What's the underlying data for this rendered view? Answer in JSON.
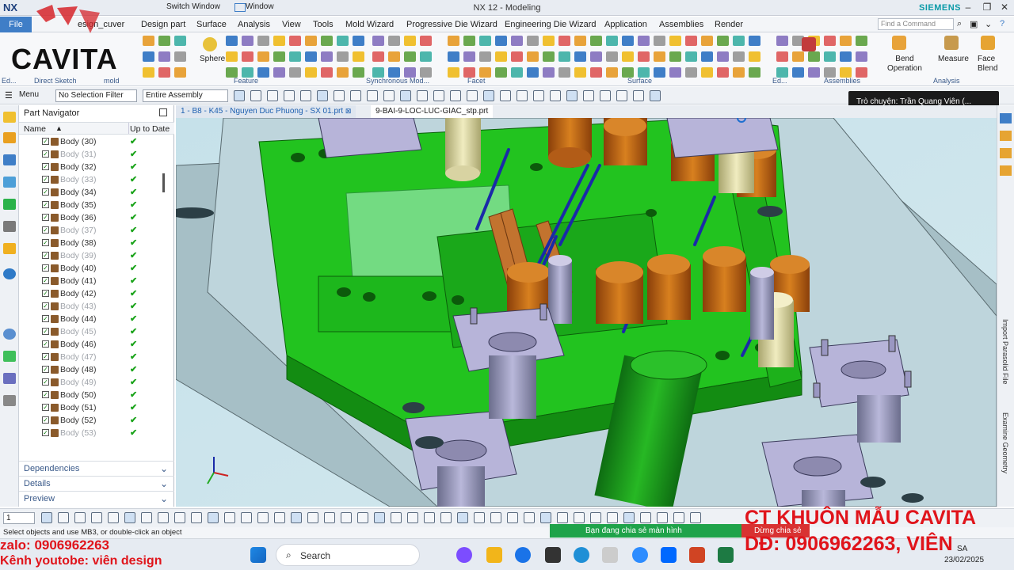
{
  "titlebar": {
    "app_short": "NX",
    "switch_window": "Switch Window",
    "window": "Window",
    "title": "NX 12 - Modeling",
    "brand": "SIEMENS"
  },
  "menubar": {
    "file": "File",
    "items": [
      "esign_cuver",
      "Design part",
      "Surface",
      "Analysis",
      "View",
      "Tools",
      "Mold Wizard",
      "Progressive Die Wizard",
      "Engineering Die Wizard",
      "Application",
      "Assemblies",
      "Render"
    ],
    "find_placeholder": "Find a Command"
  },
  "ribbon": {
    "groups": [
      "Ed...",
      "Direct Sketch",
      "mold",
      "Feature",
      "Synchronous Mod...",
      "Facet",
      "Surface",
      "Ed...",
      "Assemblies",
      "Analysis"
    ],
    "sphere": "Sphere",
    "bend_operation": "Bend\nOperation",
    "measure": "Measure",
    "face_blend": "Face\nBlend"
  },
  "toolbar": {
    "menu": "Menu",
    "filter": "No Selection Filter",
    "scope": "Entire Assembly"
  },
  "chat_popup": "Trò chuyện: Trần Quang Viên (...",
  "navigator": {
    "title": "Part Navigator",
    "col_name": "Name",
    "col_uptodate": "Up to Date",
    "rows": [
      {
        "label": "Body (30)",
        "dim": false
      },
      {
        "label": "Body (31)",
        "dim": true
      },
      {
        "label": "Body (32)",
        "dim": false
      },
      {
        "label": "Body (33)",
        "dim": true
      },
      {
        "label": "Body (34)",
        "dim": false
      },
      {
        "label": "Body (35)",
        "dim": false
      },
      {
        "label": "Body (36)",
        "dim": false
      },
      {
        "label": "Body (37)",
        "dim": true
      },
      {
        "label": "Body (38)",
        "dim": false
      },
      {
        "label": "Body (39)",
        "dim": true
      },
      {
        "label": "Body (40)",
        "dim": false
      },
      {
        "label": "Body (41)",
        "dim": false
      },
      {
        "label": "Body (42)",
        "dim": false
      },
      {
        "label": "Body (43)",
        "dim": true
      },
      {
        "label": "Body (44)",
        "dim": false
      },
      {
        "label": "Body (45)",
        "dim": true
      },
      {
        "label": "Body (46)",
        "dim": false
      },
      {
        "label": "Body (47)",
        "dim": true
      },
      {
        "label": "Body (48)",
        "dim": false
      },
      {
        "label": "Body (49)",
        "dim": true
      },
      {
        "label": "Body (50)",
        "dim": false
      },
      {
        "label": "Body (51)",
        "dim": false
      },
      {
        "label": "Body (52)",
        "dim": false
      },
      {
        "label": "Body (53)",
        "dim": true
      }
    ],
    "sections": [
      "Dependencies",
      "Details",
      "Preview"
    ]
  },
  "tabs": [
    "1 - B8 - K45 - Nguyen Duc Phuong - SX 01.prt",
    "9-BAI-9-LOC-LUC-GIAC_stp.prt"
  ],
  "right_strip_texts": [
    "Import Parasolid File",
    "Examine Geometry"
  ],
  "status": "Select objects and use MB3, or double-click an object",
  "bottom_zoom": "1",
  "sharing": {
    "message": "Bạn đang chia sẻ màn hình",
    "stop": "Dừng chia sẻ"
  },
  "taskbar": {
    "search": "Search",
    "time": "SA",
    "date": "23/02/2025"
  },
  "watermark": {
    "logo": "CAVITA",
    "zalo": "zalo: 0906962263",
    "youtube": "Kênh youtobe: viên design",
    "right1": "CT KHUÔN MẪU CAVITA",
    "right2": "DĐ: 0906962263, VIÊN"
  },
  "colors": {
    "accent": "#3f7ec7",
    "green_plate": "#22c31f",
    "orange_pin": "#c8691c",
    "lavender": "#b7b4d9",
    "watermark_red": "#e0141b"
  }
}
